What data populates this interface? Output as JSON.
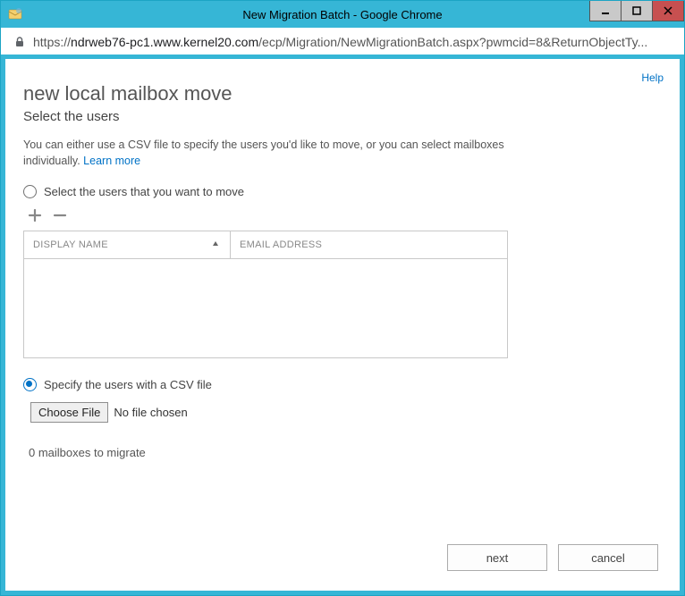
{
  "window": {
    "title": "New Migration Batch - Google Chrome"
  },
  "addressbar": {
    "protocol": "https://",
    "host": "ndrweb76-pc1.www.kernel20.com",
    "path": "/ecp/Migration/NewMigrationBatch.aspx?pwmcid=8&ReturnObjectTy..."
  },
  "page": {
    "help_label": "Help",
    "title": "new local mailbox move",
    "subtitle": "Select the users",
    "description_prefix": "You can either use a CSV file to specify the users you'd like to move, or you can select mailboxes individually. ",
    "learn_more": "Learn more"
  },
  "options": {
    "select_users_label": "Select the users that you want to move",
    "csv_label": "Specify the users with a CSV file",
    "selected": "csv"
  },
  "grid": {
    "columns": {
      "display_name": "DISPLAY NAME",
      "email": "EMAIL ADDRESS"
    },
    "rows": []
  },
  "file": {
    "choose_label": "Choose File",
    "no_file_label": "No file chosen"
  },
  "status": {
    "text": "0 mailboxes to migrate"
  },
  "buttons": {
    "next": "next",
    "cancel": "cancel"
  }
}
